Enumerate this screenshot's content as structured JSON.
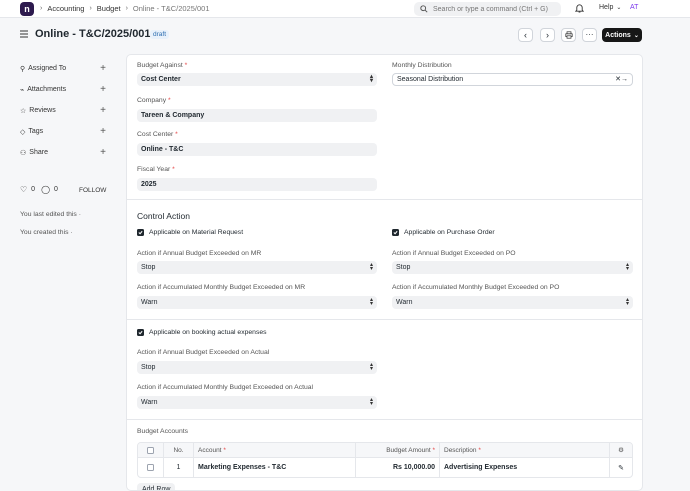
{
  "navbar": {
    "logo_letter": "n",
    "breadcrumbs": [
      "Accounting",
      "Budget",
      "Online - T&C/2025/001"
    ],
    "search_placeholder": "Search or type a command (Ctrl + G)",
    "help_label": "Help",
    "avatar_initials": "AT"
  },
  "header": {
    "title": "Online - T&C/2025/001",
    "status": "draft",
    "actions_label": "Actions"
  },
  "sidebar": {
    "items": [
      {
        "label": "Assigned To",
        "icon": "user-icon"
      },
      {
        "label": "Attachments",
        "icon": "paperclip-icon"
      },
      {
        "label": "Reviews",
        "icon": "star-icon"
      },
      {
        "label": "Tags",
        "icon": "tag-icon"
      },
      {
        "label": "Share",
        "icon": "share-icon"
      }
    ],
    "likes": "0",
    "comments": "0",
    "follow_label": "FOLLOW",
    "edited_note": "You last edited this ·",
    "created_note": "You created this ·"
  },
  "form": {
    "budget_against": {
      "label": "Budget Against",
      "value": "Cost Center"
    },
    "company": {
      "label": "Company",
      "value": "Tareen & Company"
    },
    "cost_center": {
      "label": "Cost Center",
      "value": "Online - T&C"
    },
    "fiscal_year": {
      "label": "Fiscal Year",
      "value": "2025"
    },
    "monthly_distribution": {
      "label": "Monthly Distribution",
      "value": "Seasonal Distribution"
    }
  },
  "control_action": {
    "title": "Control Action",
    "mr": {
      "checkbox_label": "Applicable on Material Request",
      "annual_label": "Action if Annual Budget Exceeded on MR",
      "annual_value": "Stop",
      "monthly_label": "Action if Accumulated Monthly Budget Exceeded on MR",
      "monthly_value": "Warn"
    },
    "po": {
      "checkbox_label": "Applicable on Purchase Order",
      "annual_label": "Action if Annual Budget Exceeded on PO",
      "annual_value": "Stop",
      "monthly_label": "Action if Accumulated Monthly Budget Exceeded on PO",
      "monthly_value": "Warn"
    },
    "actual": {
      "checkbox_label": "Applicable on booking actual expenses",
      "annual_label": "Action if Annual Budget Exceeded on Actual",
      "annual_value": "Stop",
      "monthly_label": "Action if Accumulated Monthly Budget Exceeded on Actual",
      "monthly_value": "Warn"
    }
  },
  "budget_accounts": {
    "title": "Budget Accounts",
    "columns": {
      "no": "No.",
      "account": "Account",
      "amount": "Budget Amount",
      "description": "Description"
    },
    "rows": [
      {
        "no": "1",
        "account": "Marketing Expenses - T&C",
        "amount": "Rs 10,000.00",
        "description": "Advertising Expenses"
      }
    ],
    "add_row_label": "Add Row"
  }
}
